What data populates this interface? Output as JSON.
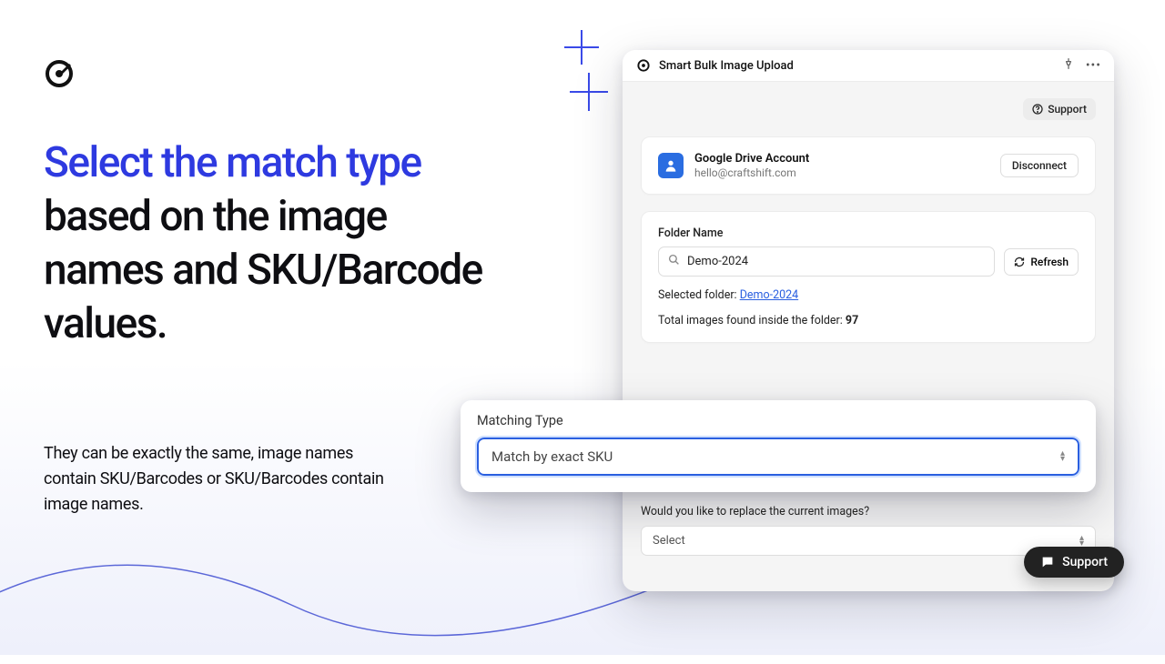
{
  "marketing": {
    "headline_highlight": "Select the match type",
    "headline_rest": " based on the image names and SKU/Barcode values.",
    "subtext": "They can be exactly the same, image names contain SKU/Barcodes or SKU/Barcodes contain image names."
  },
  "window": {
    "title": "Smart Bulk Image Upload"
  },
  "support_button": "Support",
  "account": {
    "title": "Google Drive Account",
    "email": "hello@craftshift.com",
    "disconnect": "Disconnect"
  },
  "folder": {
    "label": "Folder Name",
    "value": "Demo-2024",
    "refresh": "Refresh",
    "selected_prefix": "Selected folder: ",
    "selected_link": "Demo-2024",
    "total_prefix": "Total images found inside the folder: ",
    "total_count": "97"
  },
  "match": {
    "label": "Matching Type",
    "selected": "Match by exact SKU"
  },
  "replace": {
    "label": "Would you like to replace the current images?",
    "placeholder": "Select"
  },
  "support_pill": "Support"
}
